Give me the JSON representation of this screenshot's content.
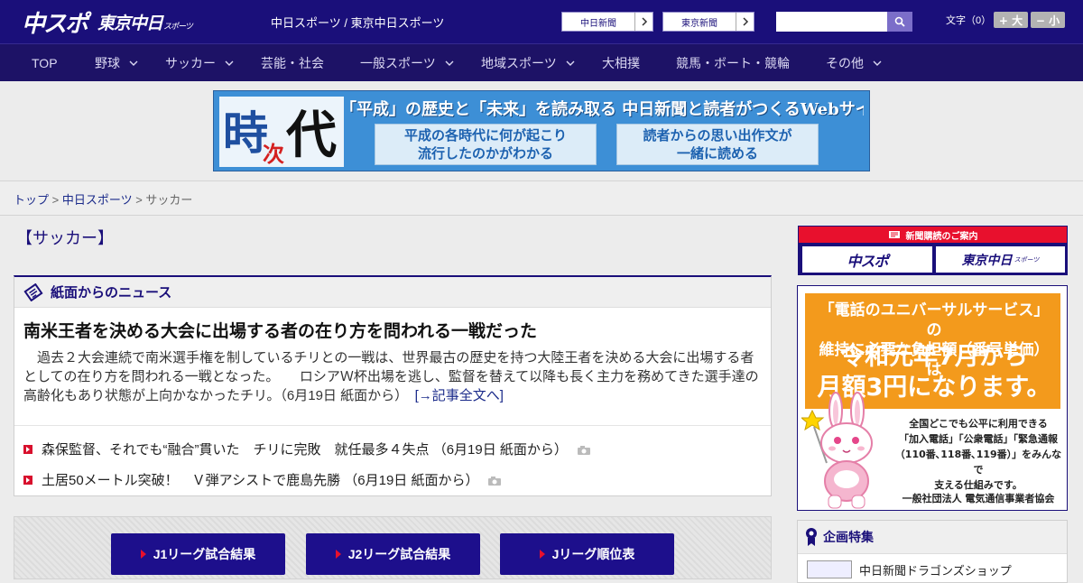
{
  "header": {
    "logo_chuspo": "中スポ",
    "logo_tokyo": "東京中日",
    "logo_tokyo_suffix": "スポーツ",
    "site_names": "中日スポーツ / 東京中日スポーツ",
    "link_chunichi": "中日新聞",
    "link_tokyo": "東京新聞",
    "search_placeholder": "",
    "fontsize_label": "文字（0）",
    "fontsize_plus": "+ 大",
    "fontsize_minus": "− 小"
  },
  "nav": {
    "items": [
      {
        "label": "TOP"
      },
      {
        "label": "野球"
      },
      {
        "label": "サッカー"
      },
      {
        "label": "芸能・社会"
      },
      {
        "label": "一般スポーツ"
      },
      {
        "label": "地域スポーツ"
      },
      {
        "label": "大相撲"
      },
      {
        "label": "競馬・ボート・競輪"
      },
      {
        "label": "その他"
      }
    ]
  },
  "banner": {
    "ji": "時",
    "tsugi": "次",
    "dai": "代",
    "headline": "「平成」の歴史と「未来」を読み取る 中日新聞と読者がつくるWebサイト",
    "box1_line1": "平成の各時代に何が起こり",
    "box1_line2": "流行したのかがわかる",
    "box2_line1": "読者からの思い出作文が",
    "box2_line2": "一緒に読める"
  },
  "breadcrumb": {
    "top": "トップ",
    "sep": " > ",
    "chunichi_sports": "中日スポーツ",
    "current": "サッカー"
  },
  "main": {
    "page_title": "【サッカー】",
    "news_panel_title": "紙面からのニュース",
    "lead_title": "南米王者を決める大会に出場する者の在り方を問われる一戦だった",
    "lead_body": "過去２大会連続で南米選手権を制しているチリとの一戦は、世界最古の歴史を持つ大陸王者を決める大会に出場する者としての在り方を問われる一戦となった。　　ロシアＷ杯出場を逃し、監督を替えて以降も長く主力を務めてきた選手達の高齢化もあり状態が上向かなかったチリ。（6月19日 紙面から）　",
    "lead_more": "[→記事全文へ]",
    "news_items": [
      {
        "text": "森保監督、それでも“融合”貫いた　チリに完敗　就任最多４失点 （6月19日 紙面から）"
      },
      {
        "text": "土居50メートル突破！　Ｖ弾アシストで鹿島先勝 （6月19日 紙面から）"
      }
    ],
    "results_buttons": [
      {
        "label": "J1リーグ試合結果"
      },
      {
        "label": "J2リーグ試合結果"
      },
      {
        "label": "Jリーグ順位表"
      }
    ]
  },
  "sidebar": {
    "subscribe_head": "新聞購読のご案内",
    "subscribe_chuspo": "中スポ",
    "subscribe_tokyo": "東京中日",
    "subscribe_tokyo_suffix": "スポーツ",
    "ad_line1a": "「電話のユニバーサルサービス」の",
    "ad_line1b": "維持に必要な負担額（番号単価）は",
    "ad_line2a": "令和元年7月から",
    "ad_line2b": "月額3円になります。",
    "ad_desc_1": "全国どこでも公平に利用できる",
    "ad_desc_2": "「加入電話」「公衆電話」「緊急通報",
    "ad_desc_3": "（110番､118番､119番）」をみんなで",
    "ad_desc_4": "支える仕組みです。",
    "ad_org": "一般社団法人 電気通信事業者協会",
    "feature_title": "企画特集",
    "feature_item": "中日新聞ドラゴンズショップ"
  },
  "colors": {
    "header_bg": "#1a0f7a",
    "nav_bg": "#1d1266",
    "accent_red": "#e8102d",
    "ad_orange": "#f39a1c"
  }
}
